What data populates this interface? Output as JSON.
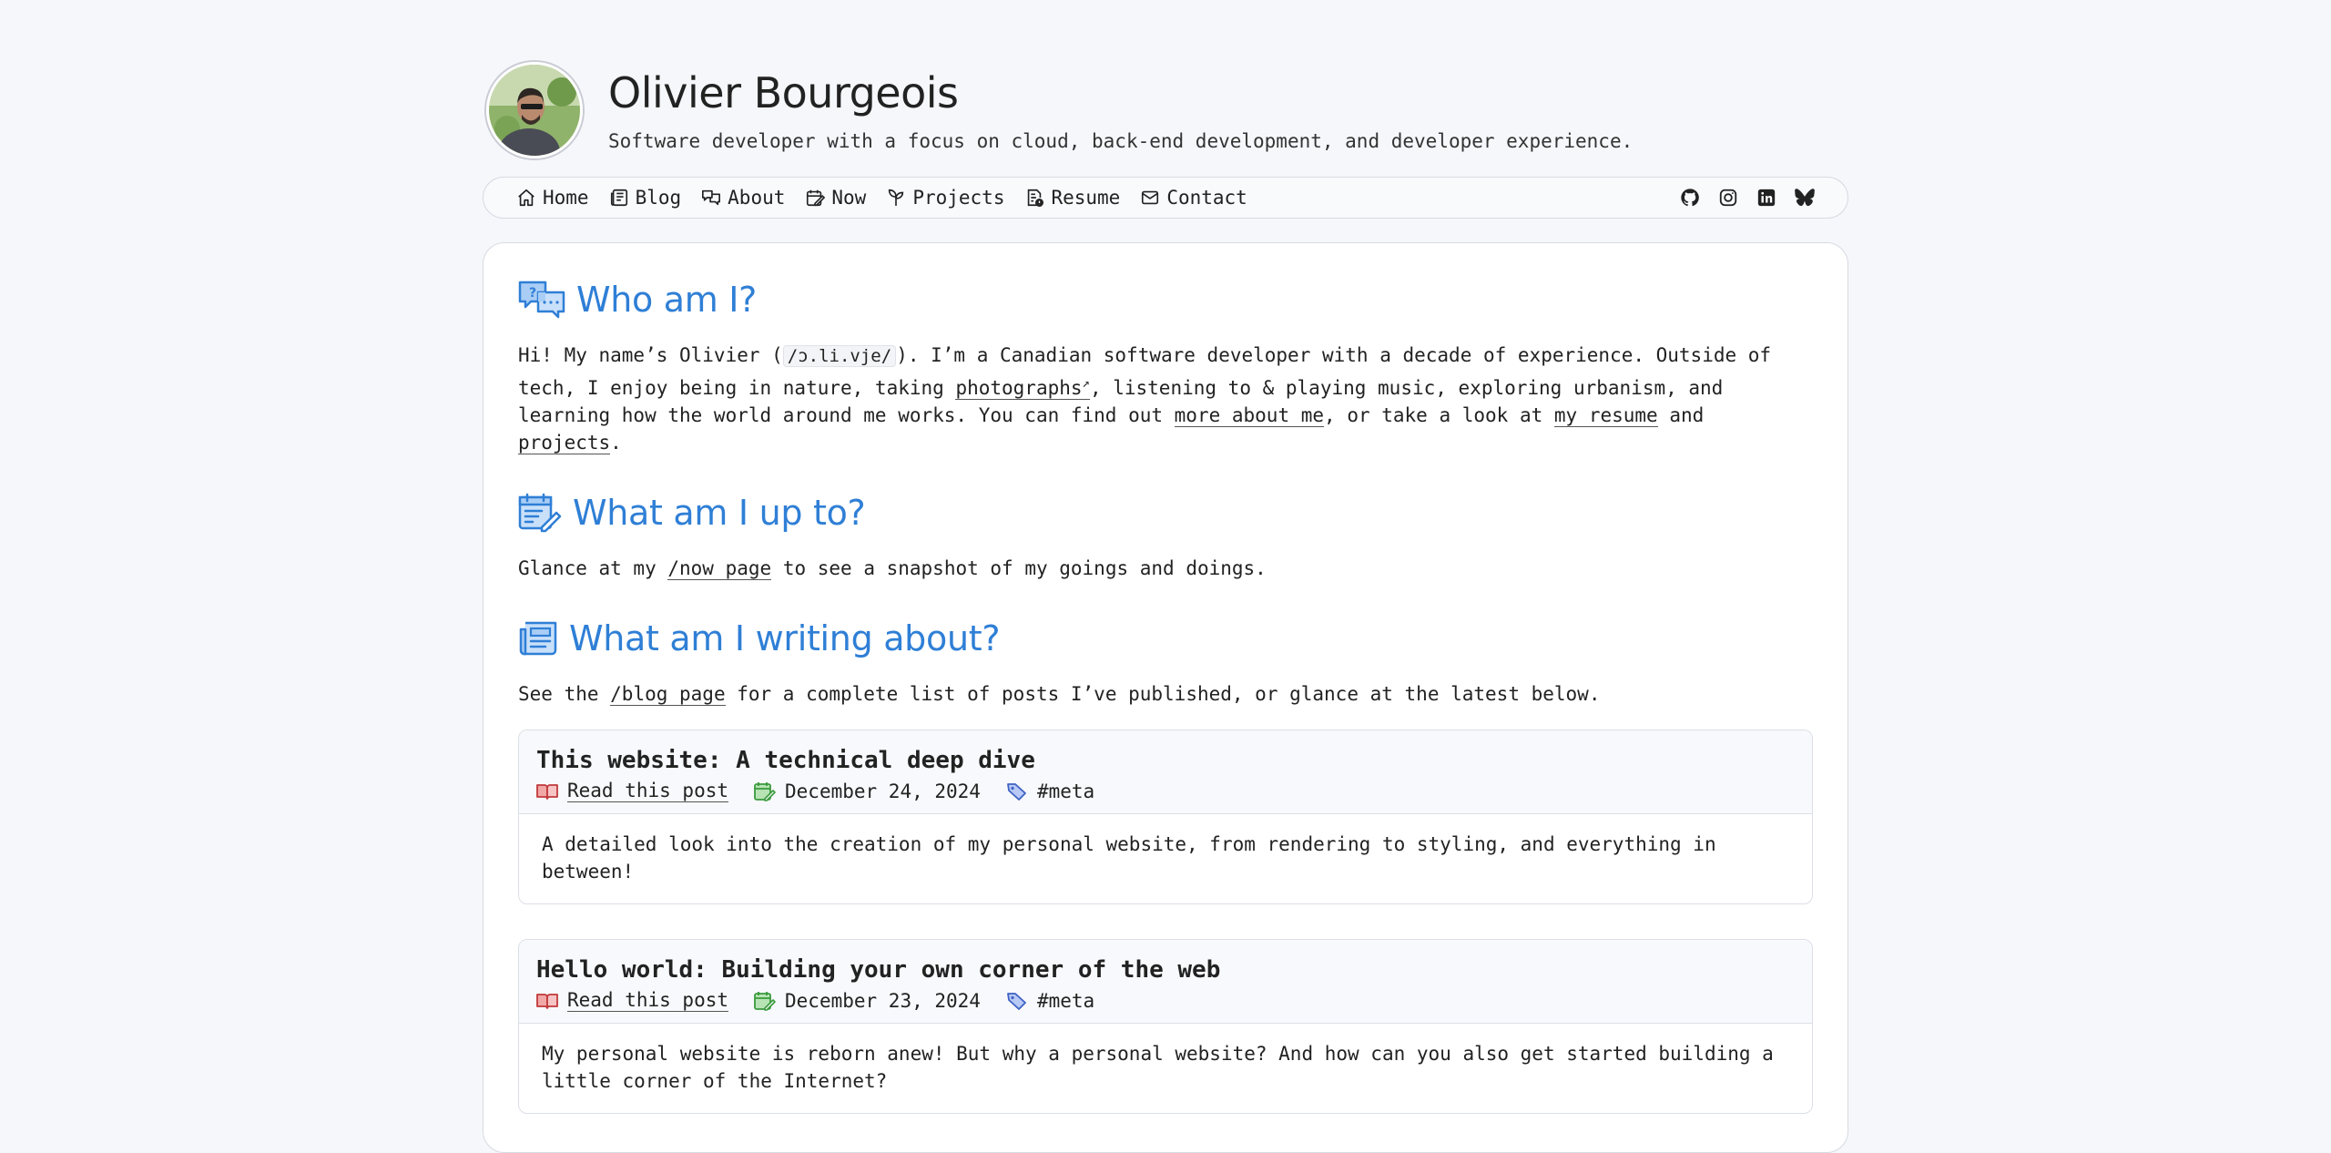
{
  "site": {
    "title": "Olivier Bourgeois",
    "tagline": "Software developer with a focus on cloud, back-end development, and developer experience."
  },
  "nav": {
    "items": [
      {
        "label": "Home",
        "icon": "home-icon"
      },
      {
        "label": "Blog",
        "icon": "blog-icon"
      },
      {
        "label": "About",
        "icon": "about-icon"
      },
      {
        "label": "Now",
        "icon": "now-icon"
      },
      {
        "label": "Projects",
        "icon": "projects-icon"
      },
      {
        "label": "Resume",
        "icon": "resume-icon"
      },
      {
        "label": "Contact",
        "icon": "contact-icon"
      }
    ],
    "social": [
      "github-icon",
      "instagram-icon",
      "linkedin-icon",
      "bluesky-icon"
    ]
  },
  "who": {
    "heading": "Who am I?",
    "t1": "Hi! My name’s Olivier (",
    "ipa": "/ɔ.li.vje/",
    "t2": "). I’m a Canadian software developer with a decade of experience. Outside of tech, I enjoy being in nature, taking ",
    "photographs": "photographs",
    "t3": ", listening to & playing music, exploring urbanism, and learning how the world around me works. You can find out ",
    "more_about_me": "more about me",
    "t4": ", or take a look at ",
    "my_resume": "my resume",
    "t5": " and ",
    "projects": "projects",
    "t6": "."
  },
  "now": {
    "heading": "What am I up to?",
    "t1": "Glance at my ",
    "link": "/now page",
    "t2": " to see a snapshot of my goings and doings."
  },
  "writing": {
    "heading": "What am I writing about?",
    "t1": "See the ",
    "link": "/blog page",
    "t2": " for a complete list of posts I’ve published, or glance at the latest below."
  },
  "posts": [
    {
      "title": "This website: A technical deep dive",
      "read": "Read this post",
      "date": "December 24, 2024",
      "tag": "#meta",
      "summary": "A detailed look into the creation of my personal website, from rendering to styling, and everything in between!"
    },
    {
      "title": "Hello world: Building your own corner of the web",
      "read": "Read this post",
      "date": "December 23, 2024",
      "tag": "#meta",
      "summary": "My personal website is reborn anew! But why a personal website? And how can you also get started building a little corner of the Internet?"
    }
  ],
  "colors": {
    "accent": "#2f7fd6",
    "background": "#f6f7fb"
  }
}
